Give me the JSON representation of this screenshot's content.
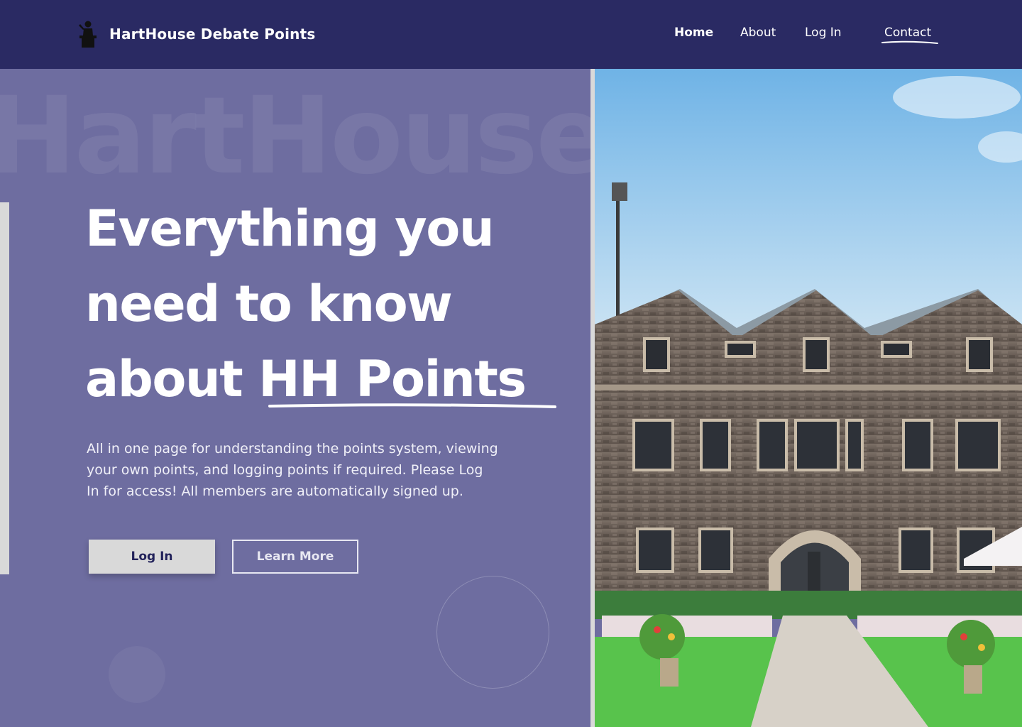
{
  "header": {
    "brand": "HartHouse Debate Points",
    "brand_icon": "debate-podium-icon",
    "nav": {
      "home": "Home",
      "about": "About",
      "login": "Log In",
      "contact": "Contact"
    }
  },
  "hero": {
    "watermark": "HartHouse",
    "headline": {
      "line1": "Everything you",
      "line2": "need to know",
      "line3_prefix": "about ",
      "line3_emphasis": "HH Points"
    },
    "description": "All in one page for understanding the points system, viewing your own points, and logging points if required. Please Log In for access! All members are automatically signed up.",
    "login_button": "Log In",
    "learn_more_button": "Learn More"
  },
  "photo": {
    "subject": "Hart House stone building with courtyard"
  },
  "colors": {
    "header_bg": "#2a2a63",
    "hero_bg": "#6e6da0",
    "accent_light": "#d9d9d9",
    "button_text": "#22225a"
  }
}
